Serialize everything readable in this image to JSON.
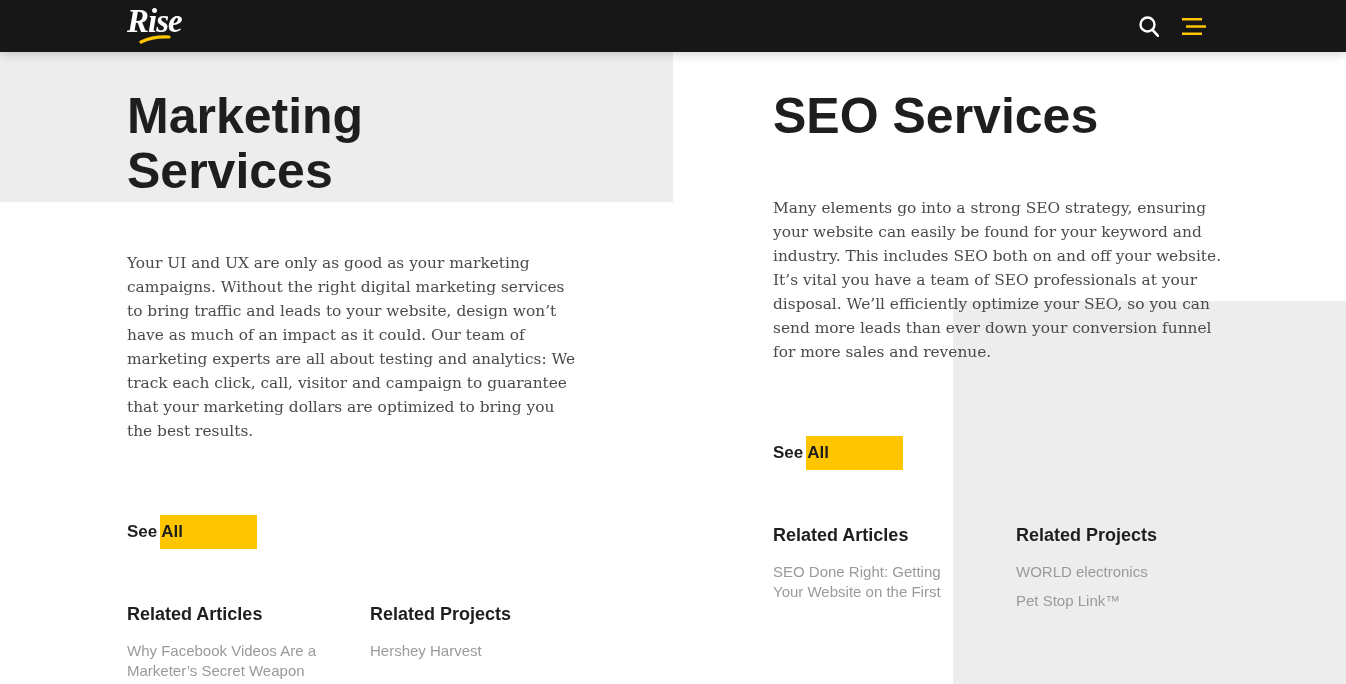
{
  "header": {
    "logo": "Rise"
  },
  "sections": [
    {
      "title": "Marketing Services",
      "body": "Your UI and UX are only as good as your marketing campaigns. Without the right digital marketing services to bring traffic and leads to your website, design won’t have as much of an impact as it could. Our team of marketing experts are all about testing and analytics: We track each click, call, visitor and campaign to guarantee that your marketing dollars are optimized to bring you the best results.",
      "link": "See All",
      "related": [
        {
          "heading": "Related Articles",
          "items": [
            "Why Facebook Videos Are a Marketer’s Secret Weapon"
          ]
        },
        {
          "heading": "Related Projects",
          "items": [
            "Hershey Harvest"
          ]
        }
      ]
    },
    {
      "title": "SEO Services",
      "body": "Many elements go into a strong SEO strategy, ensuring your website can easily be found for your keyword and industry. This includes SEO both on and off your website. It’s vital you have a team of SEO professionals at your disposal. We’ll efficiently optimize your SEO, so you can send more leads than ever down your conversion funnel for more sales and revenue.",
      "link": "See All",
      "related": [
        {
          "heading": "Related Articles",
          "items": [
            "SEO Done Right: Getting Your Website on the First"
          ]
        },
        {
          "heading": "Related Projects",
          "items": [
            "WORLD electronics",
            "Pet Stop Link™"
          ]
        }
      ]
    }
  ]
}
